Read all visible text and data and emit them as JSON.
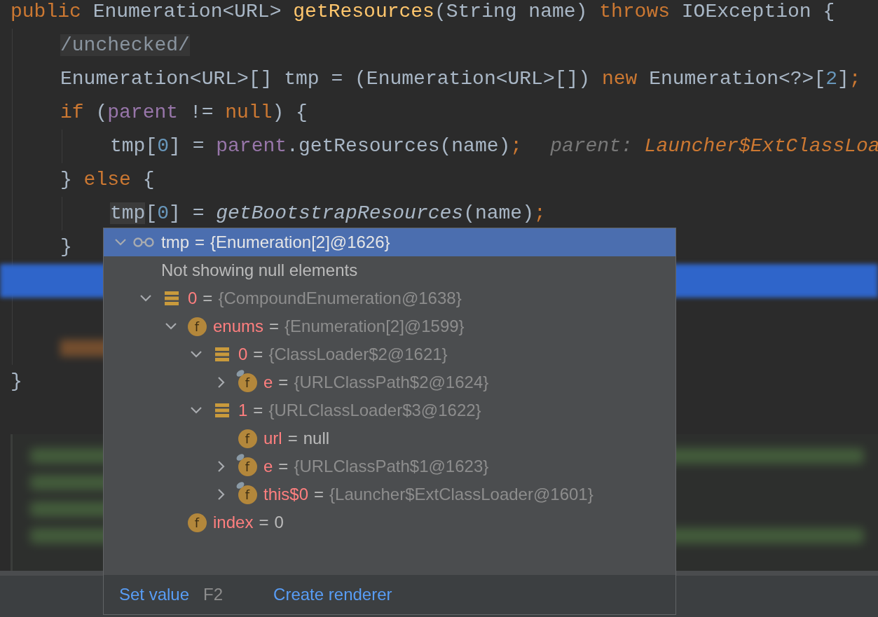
{
  "code": {
    "lines": [
      {
        "tokens": [
          {
            "kind": "keyword",
            "text": "public "
          },
          {
            "kind": "plain",
            "text": "Enumeration<URL> "
          },
          {
            "kind": "method",
            "text": "getResources"
          },
          {
            "kind": "plain",
            "text": "(String name) "
          },
          {
            "kind": "keyword",
            "text": "throws "
          },
          {
            "kind": "plain",
            "text": "IOException {"
          }
        ],
        "children": [
          {
            "tokens": [
              {
                "kind": "annotation",
                "text": "/unchecked/"
              }
            ]
          },
          {
            "tokens": [
              {
                "kind": "plain",
                "text": "Enumeration<URL>[] tmp = (Enumeration<URL>[]) "
              },
              {
                "kind": "keyword",
                "text": "new "
              },
              {
                "kind": "plain",
                "text": "Enumeration<?>["
              },
              {
                "kind": "number",
                "text": "2"
              },
              {
                "kind": "plain",
                "text": "]"
              },
              {
                "kind": "keyword",
                "text": ";"
              }
            ]
          },
          {
            "tokens": [
              {
                "kind": "keyword",
                "text": "if "
              },
              {
                "kind": "plain",
                "text": "("
              },
              {
                "kind": "field",
                "text": "parent"
              },
              {
                "kind": "plain",
                "text": " != "
              },
              {
                "kind": "keyword",
                "text": "null"
              },
              {
                "kind": "plain",
                "text": ") {"
              }
            ],
            "children": [
              {
                "tokens": [
                  {
                    "kind": "plain",
                    "text": "tmp["
                  },
                  {
                    "kind": "number",
                    "text": "0"
                  },
                  {
                    "kind": "plain",
                    "text": "] = "
                  },
                  {
                    "kind": "field",
                    "text": "parent"
                  },
                  {
                    "kind": "plain",
                    "text": ".getResources(name)"
                  },
                  {
                    "kind": "keyword",
                    "text": ";"
                  },
                  {
                    "kind": "hint",
                    "text": "parent: "
                  },
                  {
                    "kind": "hint-value",
                    "text": "Launcher$ExtClassLoa"
                  }
                ]
              }
            ]
          },
          {
            "tokens": [
              {
                "kind": "plain",
                "text": "} "
              },
              {
                "kind": "keyword",
                "text": "else "
              },
              {
                "kind": "plain",
                "text": "{"
              }
            ],
            "children": [
              {
                "tokens": [
                  {
                    "kind": "highlight",
                    "text": "tmp"
                  },
                  {
                    "kind": "plain",
                    "text": "["
                  },
                  {
                    "kind": "number",
                    "text": "0"
                  },
                  {
                    "kind": "plain",
                    "text": "] = "
                  },
                  {
                    "kind": "static-call",
                    "text": "getBootstrapResources"
                  },
                  {
                    "kind": "plain",
                    "text": "(name)"
                  },
                  {
                    "kind": "keyword",
                    "text": ";"
                  }
                ]
              }
            ]
          },
          {
            "tokens": [
              {
                "kind": "plain",
                "text": "}"
              }
            ]
          },
          {
            "kind": "blurred-current"
          },
          {
            "kind": "blurred-empty"
          },
          {
            "kind": "blurred-keyword"
          }
        ]
      },
      {
        "tokens": [
          {
            "kind": "plain",
            "text": "}"
          }
        ]
      }
    ]
  },
  "popup": {
    "root": {
      "kind": "watch",
      "name": "tmp",
      "separator": "=",
      "value": "{Enumeration[2]@1626}",
      "primitive": false,
      "expanded": true,
      "selected": true,
      "children": [
        {
          "kind": "note",
          "text": "Not showing null elements"
        },
        {
          "kind": "array",
          "name": "0",
          "separator": "=",
          "value": "{CompoundEnumeration@1638}",
          "primitive": false,
          "expanded": true,
          "selected": false,
          "children": [
            {
              "kind": "field",
              "icon_text": "f",
              "name": "enums",
              "separator": "=",
              "value": "{Enumeration[2]@1599}",
              "primitive": false,
              "expanded": true,
              "selected": false,
              "children": [
                {
                  "kind": "array",
                  "name": "0",
                  "separator": "=",
                  "value": "{ClassLoader$2@1621}",
                  "primitive": false,
                  "expanded": true,
                  "selected": false,
                  "children": [
                    {
                      "kind": "field",
                      "icon_text": "f",
                      "marked": true,
                      "name": "e",
                      "separator": "=",
                      "value": "{URLClassPath$2@1624}",
                      "primitive": false,
                      "expanded": false,
                      "selected": false
                    }
                  ]
                },
                {
                  "kind": "array",
                  "name": "1",
                  "separator": "=",
                  "value": "{URLClassLoader$3@1622}",
                  "primitive": false,
                  "expanded": true,
                  "selected": false,
                  "children": [
                    {
                      "kind": "field",
                      "icon_text": "f",
                      "name": "url",
                      "separator": "=",
                      "value": "null",
                      "primitive": true,
                      "selected": false
                    },
                    {
                      "kind": "field",
                      "icon_text": "f",
                      "marked": true,
                      "name": "e",
                      "separator": "=",
                      "value": "{URLClassPath$1@1623}",
                      "primitive": false,
                      "expanded": false,
                      "selected": false
                    },
                    {
                      "kind": "field",
                      "icon_text": "f",
                      "marked": true,
                      "name": "this$0",
                      "separator": "=",
                      "value": "{Launcher$ExtClassLoader@1601}",
                      "primitive": false,
                      "expanded": false,
                      "selected": false
                    }
                  ]
                }
              ]
            },
            {
              "kind": "field",
              "icon_text": "f",
              "name": "index",
              "separator": "=",
              "value": "0",
              "primitive": true,
              "selected": false
            }
          ]
        }
      ]
    },
    "actions": [
      {
        "label": "Set value",
        "shortcut": "F2"
      },
      {
        "label": "Create renderer"
      }
    ]
  }
}
